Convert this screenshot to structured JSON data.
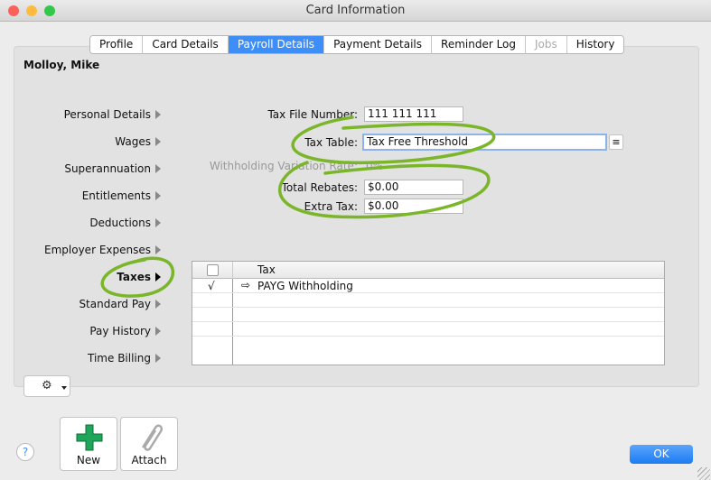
{
  "window": {
    "title": "Card Information"
  },
  "tabs": [
    {
      "label": "Profile"
    },
    {
      "label": "Card Details"
    },
    {
      "label": "Payroll Details",
      "active": true
    },
    {
      "label": "Payment Details"
    },
    {
      "label": "Reminder Log"
    },
    {
      "label": "Jobs",
      "disabled": true
    },
    {
      "label": "History"
    }
  ],
  "card_name": "Molloy, Mike",
  "nav": [
    {
      "label": "Personal Details"
    },
    {
      "label": "Wages"
    },
    {
      "label": "Superannuation"
    },
    {
      "label": "Entitlements"
    },
    {
      "label": "Deductions"
    },
    {
      "label": "Employer Expenses"
    },
    {
      "label": "Taxes",
      "active": true
    },
    {
      "label": "Standard Pay"
    },
    {
      "label": "Pay History"
    },
    {
      "label": "Time Billing"
    }
  ],
  "form": {
    "tfn_label": "Tax File Number:",
    "tfn_value": "111 111 111",
    "tax_table_label": "Tax Table:",
    "tax_table_value": "Tax Free Threshold",
    "wvr_label": "Withholding Variation Rate:",
    "wvr_value": "0%",
    "rebates_label": "Total Rebates:",
    "rebates_value": "$0.00",
    "extra_label": "Extra Tax:",
    "extra_value": "$0.00"
  },
  "tax_table": {
    "header": "Tax",
    "rows": [
      {
        "checked": "√",
        "name": "PAYG Withholding"
      }
    ]
  },
  "footer": {
    "new_label": "New",
    "attach_label": "Attach",
    "ok_label": "OK",
    "help_label": "?"
  },
  "colors": {
    "accent": "#3d8ef8",
    "annotation": "#7ab52a"
  }
}
